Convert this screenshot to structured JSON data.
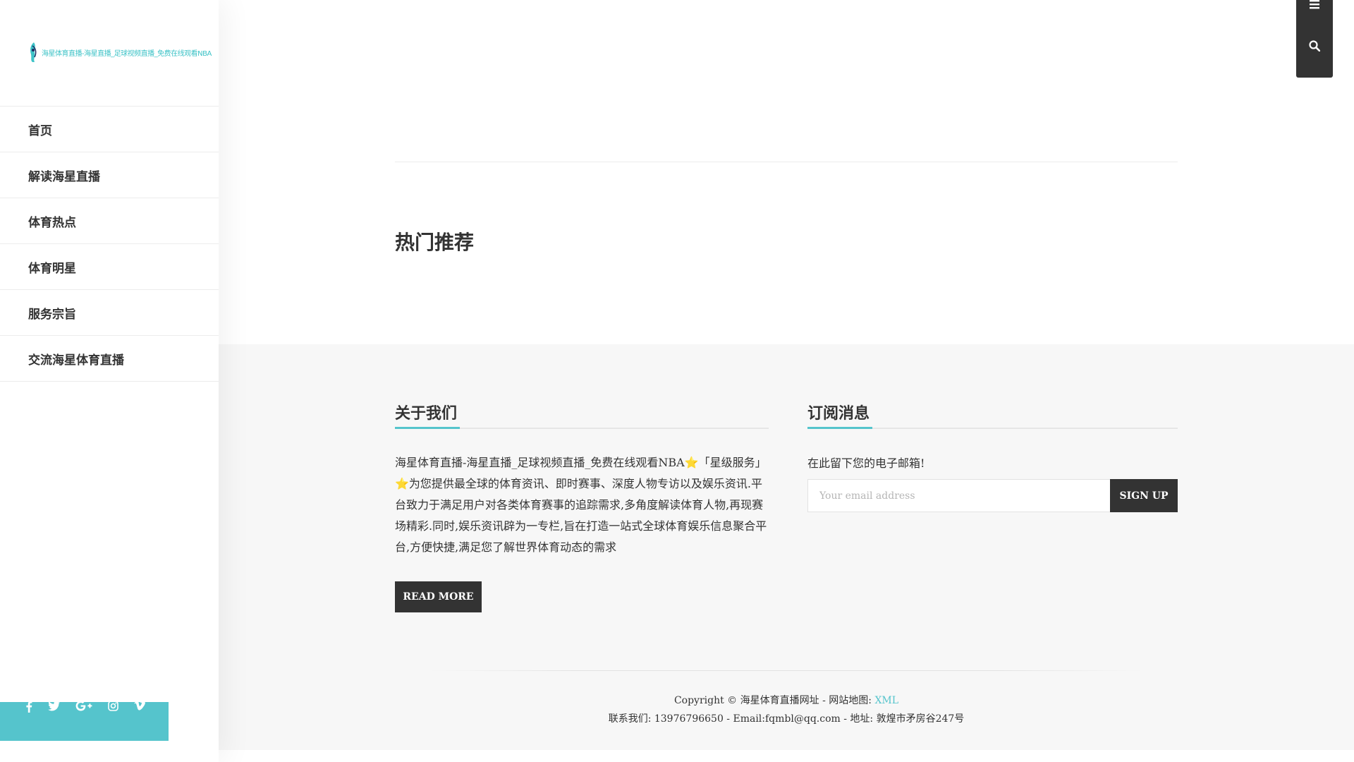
{
  "brand": {
    "logo_text": "海星体育直播-海星直播_足球视频直播_免费在线观看NBA",
    "accent_color": "#55c4cc",
    "dark_color": "#333333"
  },
  "nav": {
    "items": [
      {
        "label": "首页"
      },
      {
        "label": "解读海星直播"
      },
      {
        "label": "体育热点"
      },
      {
        "label": "体育明星"
      },
      {
        "label": "服务宗旨"
      },
      {
        "label": "交流海星体育直播"
      }
    ]
  },
  "social": {
    "icons": [
      "facebook-icon",
      "twitter-icon",
      "google-plus-icon",
      "instagram-icon",
      "vimeo-icon"
    ]
  },
  "top_buttons": {
    "icons": [
      "menu-icon",
      "search-icon"
    ]
  },
  "main": {
    "hot_title": "热门推荐"
  },
  "about": {
    "title": "关于我们",
    "text": "海星体育直播-海星直播_足球视频直播_免费在线观看NBA⭐「星级服务」⭐为您提供最全球的体育资讯、即时赛事、深度人物专访以及娱乐资讯.平台致力于满足用户对各类体育赛事的追踪需求,多角度解读体育人物,再现赛场精彩.同时,娱乐资讯辟为一专栏,旨在打造一站式全球体育娱乐信息聚合平台,方便快捷,满足您了解世界体育动态的需求",
    "button_label": "READ MORE"
  },
  "subscribe": {
    "title": "订阅消息",
    "text": "在此留下您的电子邮箱!",
    "email_placeholder": "Your email address",
    "email_value": "",
    "button_label": "SIGN UP"
  },
  "footer": {
    "copyright_prefix": "Copyright © 海星体育直播网址 - 网站地图:",
    "sitemap_link": "XML",
    "contact_line": "联系我们: 13976796650 - Email:fqmbl@qq.com - 地址: 敦煌市矛房谷247号"
  }
}
